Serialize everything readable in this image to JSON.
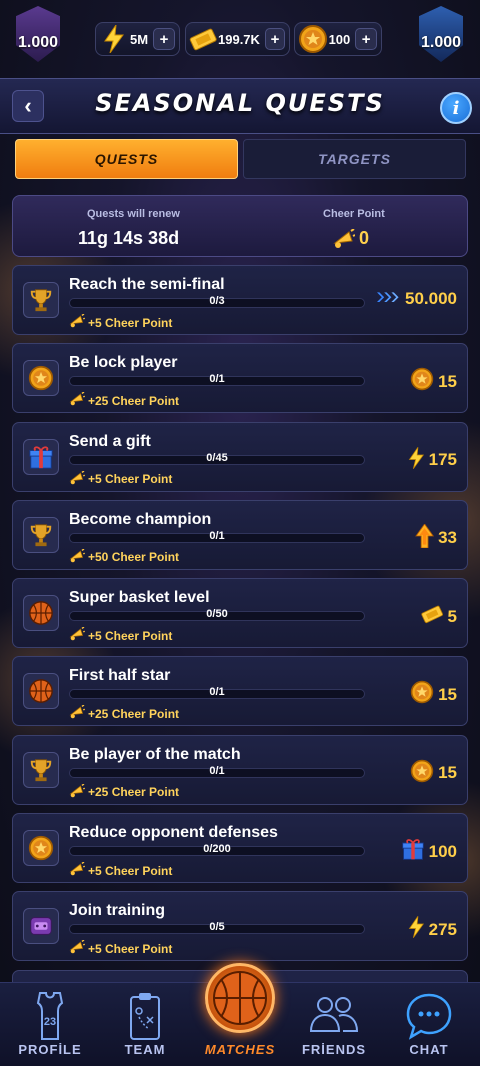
{
  "top_bar": {
    "rank_left": "1.000",
    "rank_right": "1.000",
    "energy": {
      "value": "5M",
      "icon": "lightning-icon"
    },
    "tickets": {
      "value": "199.7K",
      "icon": "ticket-icon"
    },
    "coins": {
      "value": "100",
      "icon": "coin-icon"
    },
    "plus_label": "+"
  },
  "header": {
    "title": "SEASONAL QUESTS",
    "back_label": "‹",
    "info_label": "i"
  },
  "tabs": [
    {
      "label": "QUESTS",
      "active": true
    },
    {
      "label": "TARGETS",
      "active": false
    }
  ],
  "renew": {
    "label": "Quests will renew",
    "value": "11g 14s 38d",
    "cheer_label": "Cheer Point",
    "cheer_value": "0"
  },
  "quests": [
    {
      "name": "Reach the semi-final",
      "progress": "0/3",
      "cheer": "+5 Cheer Point",
      "reward": "50.000",
      "reward_icon": "xp-arrows-icon",
      "icon": "trophy-icon"
    },
    {
      "name": "Be lock player",
      "progress": "0/1",
      "cheer": "+25 Cheer Point",
      "reward": "15",
      "reward_icon": "coin-icon",
      "icon": "coin-icon"
    },
    {
      "name": "Send a gift",
      "progress": "0/45",
      "cheer": "+5 Cheer Point",
      "reward": "175",
      "reward_icon": "lightning-icon",
      "icon": "gift-icon"
    },
    {
      "name": "Become champion",
      "progress": "0/1",
      "cheer": "+50 Cheer Point",
      "reward": "33",
      "reward_icon": "arrow-up-icon",
      "icon": "trophy-icon"
    },
    {
      "name": "Super basket level",
      "progress": "0/50",
      "cheer": "+5 Cheer Point",
      "reward": "5",
      "reward_icon": "ticket-icon",
      "icon": "basketball-icon"
    },
    {
      "name": "First half star",
      "progress": "0/1",
      "cheer": "+25 Cheer Point",
      "reward": "15",
      "reward_icon": "coin-icon",
      "icon": "basketball-icon"
    },
    {
      "name": "Be player of the match",
      "progress": "0/1",
      "cheer": "+25 Cheer Point",
      "reward": "15",
      "reward_icon": "coin-icon",
      "icon": "trophy-icon"
    },
    {
      "name": "Reduce opponent defenses",
      "progress": "0/200",
      "cheer": "+5 Cheer Point",
      "reward": "100",
      "reward_icon": "gift-icon",
      "icon": "coin-icon"
    },
    {
      "name": "Join training",
      "progress": "0/5",
      "cheer": "+5 Cheer Point",
      "reward": "275",
      "reward_icon": "lightning-icon",
      "icon": "training-icon"
    }
  ],
  "nav": [
    {
      "label": "PROFİLE",
      "icon": "jersey-icon",
      "jersey_number": "23"
    },
    {
      "label": "TEAM",
      "icon": "clipboard-icon"
    },
    {
      "label": "MATCHES",
      "icon": "basketball-icon",
      "active": true
    },
    {
      "label": "FRİENDS",
      "icon": "friends-icon"
    },
    {
      "label": "CHAT",
      "icon": "chat-icon"
    }
  ],
  "colors": {
    "accent": "#f59a1e",
    "gold": "#ffcf4a",
    "panel": "#1f2346"
  }
}
